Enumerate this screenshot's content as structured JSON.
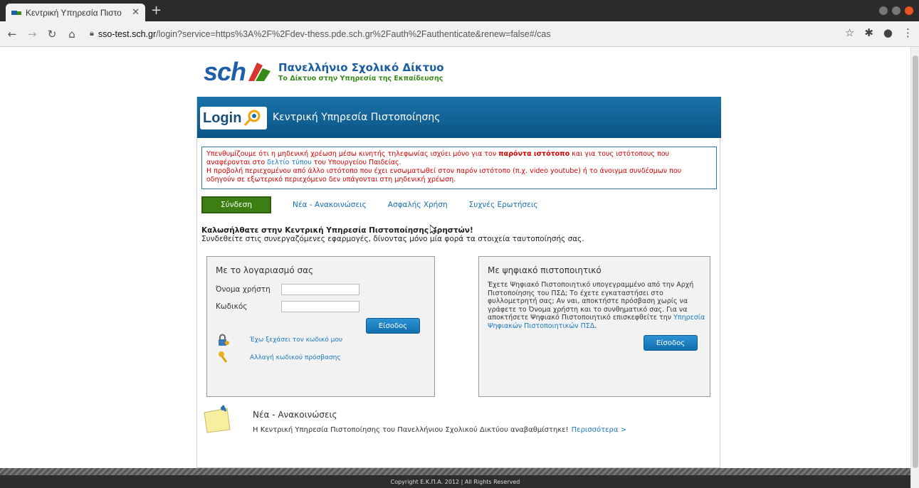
{
  "browser": {
    "tab_title": "Κεντρική Υπηρεσία Πιστο",
    "url_host": "sso-test.sch.gr",
    "url_rest": "/login?service=https%3A%2F%2Fdev-thess.pde.sch.gr%2Fauth%2Fauthenticate&renew=false#/cas"
  },
  "header": {
    "logo_text": "sch",
    "title": "Πανελλήνιο Σχολικό Δίκτυο",
    "subtitle": "Το Δίκτυο στην Υπηρεσία της Εκπαίδευσης"
  },
  "banner": {
    "logo_part1": "Login",
    "title": "Κεντρική Υπηρεσία Πιστοποίησης"
  },
  "notice": {
    "part1": "Υπενθυμίζουμε ότι η μηδενική χρέωση μέσω κινητής τηλεφωνίας ισχύει μόνο για τον ",
    "bold": "παρόντα ιστότοπο",
    "part2": " και για τους ιστότοπους που αναφέρονται στο ",
    "link": "δελτίο τύπου",
    "part3": " του Υπουργείου Παιδείας.",
    "line2": "Η προβολή περιεχομένου από άλλο ιστότοπο που έχει ενσωματωθεί στον παρόν ιστότοπο (π.χ. video youtube) ή το άνοιγμα συνδέσμων που οδηγούν σε εξωτερικό περιεχόμενο δεν υπάγονται στη μηδενική χρέωση."
  },
  "nav": {
    "active": "Σύνδεση",
    "items": [
      "Νέα - Ανακοινώσεις",
      "Ασφαλής Χρήση",
      "Συχνές Ερωτήσεις"
    ]
  },
  "welcome": {
    "title": "Καλωσήλθατε στην Κεντρική Υπηρεσία Πιστοποίησης Χρηστών!",
    "text": "Συνδεθείτε στις συνεργαζόμενες εφαρμογές, δίνοντας μόνο μία φορά τα στοιχεία ταυτοποίησής σας."
  },
  "account_panel": {
    "title": "Με το λογαριασμό σας",
    "username_label": "Όνομα χρήστη",
    "password_label": "Κωδικός",
    "username_value": "",
    "password_value": "",
    "login_button": "Είσοδος",
    "forgot_link": "Έχω ξεχάσει τον κωδικό μου",
    "change_link": "Αλλαγή κωδικού πρόσβασης"
  },
  "cert_panel": {
    "title": "Με ψηφιακό πιστοποιητικό",
    "text": "Έχετε Ψηφιακό Πιστοποιητικό υπογεγραμμένο από την Αρχή Πιστοποίησης του ΠΣΔ; Το έχετε εγκαταστήσει στο φυλλομετρητή σας; Αν ναι, αποκτήστε πρόσβαση χωρίς να γράφετε το Όνομα χρήστη και το συνθηματικό σας. Για να αποκτήσετε Ψηφιακό Πιστοποιητικό επισκεφθείτε την ",
    "link": "Υπηρεσία Ψηφιακών Πιστοποιητικών ΠΣΔ",
    "text_end": ".",
    "login_button": "Είσοδος"
  },
  "news": {
    "title": "Νέα - Ανακοινώσεις",
    "text": "Η Κεντρική Υπηρεσία Πιστοποίησης του Πανελλήνιου Σχολικού Δικτύου αναβαθμίστηκε!",
    "more": "Περισσότερα >"
  },
  "footer": {
    "copyright": "Copyright Ε.Κ.Π.Α. 2012 | All Rights Reserved"
  },
  "colors": {
    "banner_blue": "#0e5f93",
    "nav_green": "#3d7e12",
    "notice_red": "#d40000",
    "link_blue": "#1a78c2"
  }
}
